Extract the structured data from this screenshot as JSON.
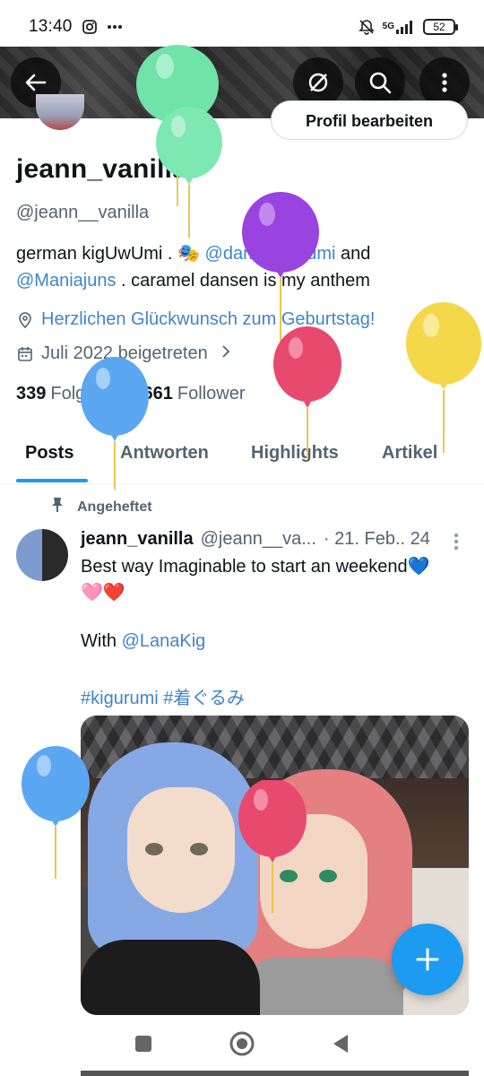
{
  "status_bar": {
    "time": "13:40",
    "battery": "52",
    "network": "5G"
  },
  "header": {
    "edit_profile_label": "Profil bearbeiten"
  },
  "profile": {
    "display_name": "jeann_vanilla",
    "handle": "@jeann__vanilla",
    "bio_part1": "german kigUwUmi . ",
    "bio_emoji": "🎭",
    "bio_mention1": "@damekigurumi",
    "bio_part2": " and ",
    "bio_mention2": "@Maniajuns",
    "bio_part3": " .  caramel dansen is my anthem",
    "birthday_text": "Herzlichen Glückwunsch zum Geburtstag!",
    "joined_text": "Juli 2022 beigetreten",
    "following_count": "339",
    "following_label": "Folge ich",
    "followers_count": "661",
    "followers_label": "Follower"
  },
  "tabs": [
    {
      "label": "Posts",
      "active": true
    },
    {
      "label": "Antworten",
      "active": false
    },
    {
      "label": "Highlights",
      "active": false
    },
    {
      "label": "Artikel",
      "active": false
    }
  ],
  "pinned_tweet": {
    "pinned_label": "Angeheftet",
    "author_name": "jeann_vanilla",
    "author_handle": "@jeann__va...",
    "date": "· 21. Feb.. 24",
    "text_line1": "Best way Imaginable to start an weekend💙",
    "text_line2": "🩷❤️",
    "with_text": "With ",
    "with_mention": "@LanaKig",
    "hashtags": "#kigurumi #着ぐるみ"
  },
  "colors": {
    "accent": "#1d9bf0",
    "link": "#3f86c9",
    "muted": "#536471",
    "text": "#0f1419"
  },
  "icons": {
    "back": "arrow-left-icon",
    "hide_media": "no-eye-icon",
    "search": "search-icon",
    "more": "more-vertical-icon",
    "compose": "plus-icon",
    "pin": "pin-icon",
    "location": "location-pin-icon",
    "calendar": "calendar-icon"
  }
}
